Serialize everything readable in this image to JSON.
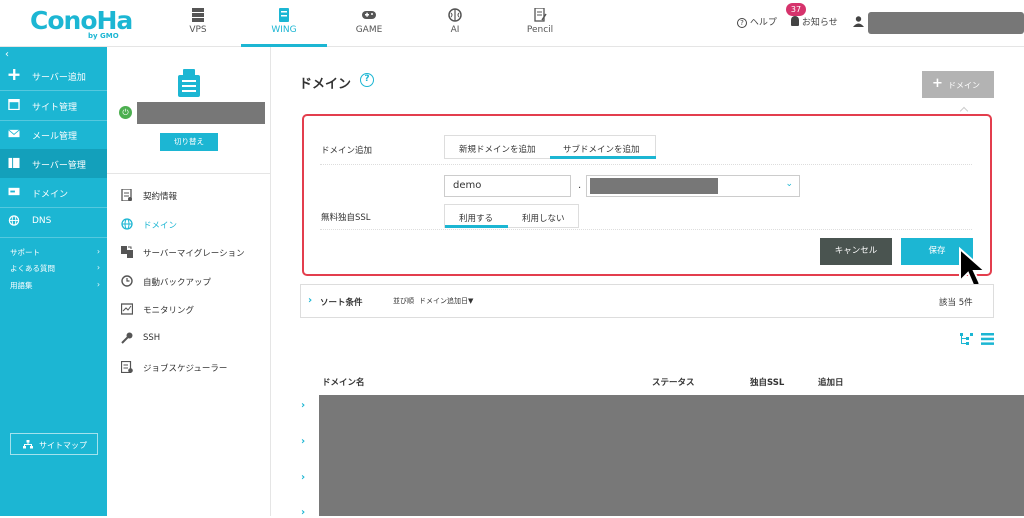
{
  "colors": {
    "accent": "#1cb6d3",
    "highlight_border": "#e33e4d",
    "cancel_bg": "#4a5450",
    "notification": "#d6336c"
  },
  "logo": {
    "text": "ConoHa",
    "by": "by GMO"
  },
  "top_nav": [
    {
      "label": "VPS",
      "icon": "server-stack-icon",
      "active": false
    },
    {
      "label": "WING",
      "icon": "wing-server-icon",
      "active": true
    },
    {
      "label": "GAME",
      "icon": "gamepad-icon",
      "active": false
    },
    {
      "label": "AI",
      "icon": "brain-icon",
      "active": false
    },
    {
      "label": "Pencil",
      "icon": "pencil-doc-icon",
      "active": false
    }
  ],
  "top_right": {
    "help": "ヘルプ",
    "notifications": "お知らせ",
    "notification_count": "37"
  },
  "sidebar": {
    "items": [
      {
        "label": "サーバー追加",
        "icon": "plus-icon"
      },
      {
        "label": "サイト管理",
        "icon": "site-icon"
      },
      {
        "label": "メール管理",
        "icon": "mail-icon"
      },
      {
        "label": "サーバー管理",
        "icon": "server-icon",
        "active": true
      },
      {
        "label": "ドメイン",
        "icon": "domain-icon"
      },
      {
        "label": "DNS",
        "icon": "globe-icon"
      }
    ],
    "links": [
      {
        "label": "サポート"
      },
      {
        "label": "よくある質問"
      },
      {
        "label": "用語集"
      }
    ],
    "sitemap": "サイトマップ"
  },
  "server_panel": {
    "switch_label": "切り替え",
    "menu": [
      {
        "label": "契約情報",
        "icon": "contract-icon"
      },
      {
        "label": "ドメイン",
        "icon": "globe-icon",
        "active": true
      },
      {
        "label": "サーバーマイグレーション",
        "icon": "migration-icon"
      },
      {
        "label": "自動バックアップ",
        "icon": "backup-icon"
      },
      {
        "label": "モニタリング",
        "icon": "monitor-icon"
      },
      {
        "label": "SSH",
        "icon": "key-icon"
      },
      {
        "label": "ジョブスケジューラー",
        "icon": "scheduler-icon"
      }
    ]
  },
  "main": {
    "title": "ドメイン",
    "add_button": "ドメイン",
    "form": {
      "domain_add_label": "ドメイン追加",
      "domain_add_options": [
        "新規ドメインを追加",
        "サブドメインを追加"
      ],
      "domain_add_selected": 1,
      "subdomain_value": "demo",
      "separator": ".",
      "ssl_label": "無料独自SSL",
      "ssl_options": [
        "利用する",
        "利用しない"
      ],
      "ssl_selected": 0,
      "cancel": "キャンセル",
      "save": "保存"
    },
    "sort": {
      "label": "ソート条件",
      "order_label": "並び順",
      "order_value": "ドメイン追加日▼",
      "count": "該当 5件"
    },
    "table": {
      "columns": [
        "ドメイン名",
        "ステータス",
        "独自SSL",
        "追加日"
      ],
      "row_count": 4
    }
  }
}
